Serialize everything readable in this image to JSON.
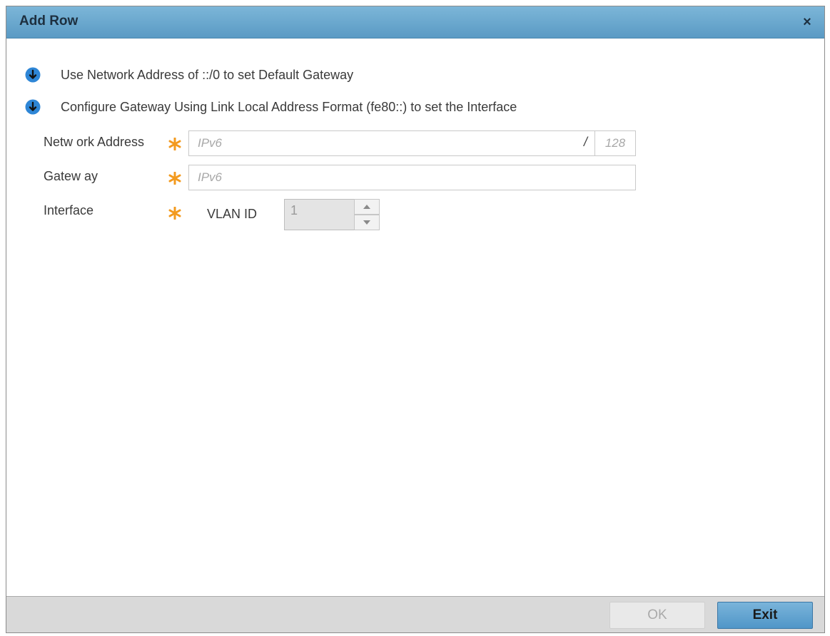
{
  "dialog": {
    "title": "Add Row",
    "close_label": "×"
  },
  "info": [
    {
      "text": "Use Network Address of ::/0 to set Default Gateway",
      "icon": "arrow-down-circle-icon"
    },
    {
      "text": "Configure Gateway Using Link Local Address Format (fe80::) to set the Interface",
      "icon": "arrow-down-circle-icon"
    }
  ],
  "form": {
    "network_address": {
      "label": "Netw ork Address",
      "placeholder": "IPv6",
      "separator": "/",
      "prefix_placeholder": "128"
    },
    "gateway": {
      "label": "Gatew ay",
      "placeholder": "IPv6"
    },
    "interface": {
      "label": "Interface",
      "vlan_label": "VLAN ID",
      "vlan_value": "1"
    }
  },
  "footer": {
    "ok_label": "OK",
    "exit_label": "Exit"
  },
  "colors": {
    "title_bar": "#6aa6cf",
    "required_star": "#f39a1e",
    "info_icon": "#2e86d6"
  }
}
